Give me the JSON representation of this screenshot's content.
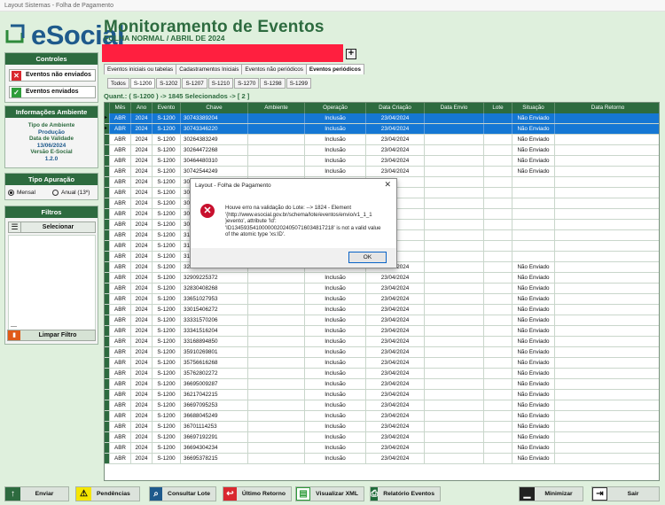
{
  "window": {
    "title": "Layout Sistemas - Folha de Pagamento"
  },
  "header": {
    "logo_text": "eSocial",
    "title": "Monitoramento de Eventos",
    "subtitle": "FOLHA NORMAL / ABRIL DE 2024",
    "plus_label": "+"
  },
  "sidebar": {
    "controles": {
      "title": "Controles",
      "nao_enviados": "Eventos não enviados",
      "enviados": "Eventos enviados"
    },
    "ambiente": {
      "title": "Informações Ambiente",
      "tipo_label": "Tipo de Ambiente",
      "tipo_value": "Produção",
      "validade_label": "Data de Validade",
      "validade_value": "13/06/2024",
      "versao_label": "Versão E-Social",
      "versao_value": "1.2.0"
    },
    "apuracao": {
      "title": "Tipo Apuração",
      "mensal": "Mensal",
      "anual": "Anual (13º)"
    },
    "filtros": {
      "title": "Filtros",
      "selecionar": "Selecionar",
      "limpar": "Limpar Filtro",
      "dash": "—"
    }
  },
  "tabs_main": [
    "Eventos iniciais ou tabelas",
    "Cadastramentos Iniciais",
    "Eventos não periódicos",
    "Eventos periódicos"
  ],
  "tabs_sub": [
    "Todos",
    "S-1200",
    "S-1202",
    "S-1207",
    "S-1210",
    "S-1270",
    "S-1298",
    "S-1299"
  ],
  "quantity": "Quant.: ( S-1200 ) -> 1845 Selecionados -> [ 2 ]",
  "grid": {
    "columns": [
      "Mês",
      "Ano",
      "Evento",
      "Chave",
      "Ambiente",
      "Operação",
      "Data Criação",
      "Data Envio",
      "Lote",
      "Situação",
      "Data Retorno"
    ],
    "defaults": {
      "mes": "ABR",
      "ano": "2024",
      "evento": "S-1200",
      "operacao": "Inclusão",
      "data_criacao": "23/04/2024",
      "situacao": "Não Enviado"
    },
    "chaves": [
      "30743389204",
      "30743346220",
      "30264383249",
      "30264472268",
      "30464480310",
      "30742544249",
      "30",
      "30",
      "30",
      "30",
      "30",
      "31",
      "31",
      "31",
      "32259069134",
      "32909225372",
      "32830408268",
      "33651027953",
      "33015406272",
      "33331570206",
      "33341516204",
      "33168894850",
      "35910269801",
      "35756616268",
      "35762802272",
      "36695009287",
      "36217042215",
      "36697095253",
      "36688045249",
      "36701114253",
      "36697192291",
      "36694304234",
      "36695378215"
    ],
    "hidden_rows": [
      6,
      7,
      8,
      9,
      10,
      11,
      12,
      13
    ],
    "selected_rows": [
      0,
      1
    ]
  },
  "dialog": {
    "title": "Layout - Folha de Pagamento",
    "message": "Houve erro na validação do Lote: --> 1824 - Element\n'{http://www.esocial.gov.br/schema/lote/eventos/envio/v1_1_1\n}evento', attribute 'Id':\n'ID1345935410000002024050716034817218' is not a valid value\nof the atomic type 'xs:ID'.",
    "ok": "OK",
    "close": "✕"
  },
  "toolbar": {
    "enviar": "Enviar",
    "pendencias": "Pendências",
    "consultar": "Consultar Lote",
    "retorno": "Último Retorno",
    "xml": "Visualizar XML",
    "relatorio": "Relatório Eventos",
    "minimizar": "Minimizar",
    "sair": "Sair"
  },
  "colors": {
    "brand_green": "#2d6b3f",
    "selection_blue": "#1577d4",
    "error_red": "#ff1f3f"
  }
}
